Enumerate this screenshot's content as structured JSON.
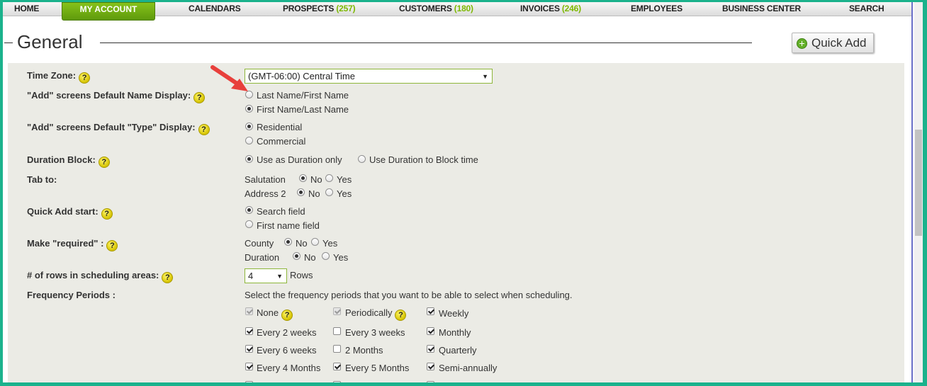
{
  "nav": {
    "home": "HOME",
    "my_account": "MY ACCOUNT",
    "calendars": "CALENDARS",
    "prospects": "PROSPECTS",
    "prospects_count": "(257)",
    "customers": "CUSTOMERS",
    "customers_count": "(180)",
    "invoices": "INVOICES",
    "invoices_count": "(246)",
    "employees": "EMPLOYEES",
    "business_center": "BUSINESS CENTER",
    "search": "SEARCH"
  },
  "page": {
    "title": "General",
    "quick_add": "Quick Add"
  },
  "form": {
    "time_zone": {
      "label": "Time Zone:",
      "value": "(GMT-06:00) Central Time"
    },
    "name_display": {
      "label": "\"Add\" screens Default Name Display:",
      "opt1": "Last Name/First Name",
      "opt2": "First Name/Last Name",
      "selected": "First Name/Last Name"
    },
    "type_display": {
      "label": "\"Add\" screens Default \"Type\" Display:",
      "opt1": "Residential",
      "opt2": "Commercial",
      "selected": "Residential"
    },
    "duration_block": {
      "label": "Duration Block:",
      "opt1": "Use as Duration only",
      "opt2": "Use Duration to Block time",
      "selected": "Use as Duration only"
    },
    "tab_to": {
      "label": "Tab to:",
      "row1": "Salutation",
      "row2": "Address 2",
      "no": "No",
      "yes": "Yes"
    },
    "quick_add_start": {
      "label": "Quick Add start:",
      "opt1": "Search field",
      "opt2": "First name field",
      "selected": "Search field"
    },
    "make_required": {
      "label": "Make \"required\" :",
      "row1": "County",
      "row2": "Duration",
      "no": "No",
      "yes": "Yes"
    },
    "rows_sched": {
      "label": "# of rows in scheduling areas:",
      "value": "4",
      "suffix": "Rows"
    },
    "freq": {
      "label": "Frequency Periods :",
      "instruction": "Select the frequency periods that you want to be able to select when scheduling.",
      "col1": [
        "None",
        "Every 2 weeks",
        "Every 6 weeks",
        "Every 4 Months"
      ],
      "col2": [
        "Periodically",
        "Every 3 weeks",
        "2 Months",
        "Every 5 Months"
      ],
      "col3": [
        "Weekly",
        "Monthly",
        "Quarterly",
        "Semi-annually"
      ]
    }
  },
  "colors": {
    "accent_green": "#6cab12",
    "frame": "#1bb28c",
    "arrow": "#e8403c"
  }
}
